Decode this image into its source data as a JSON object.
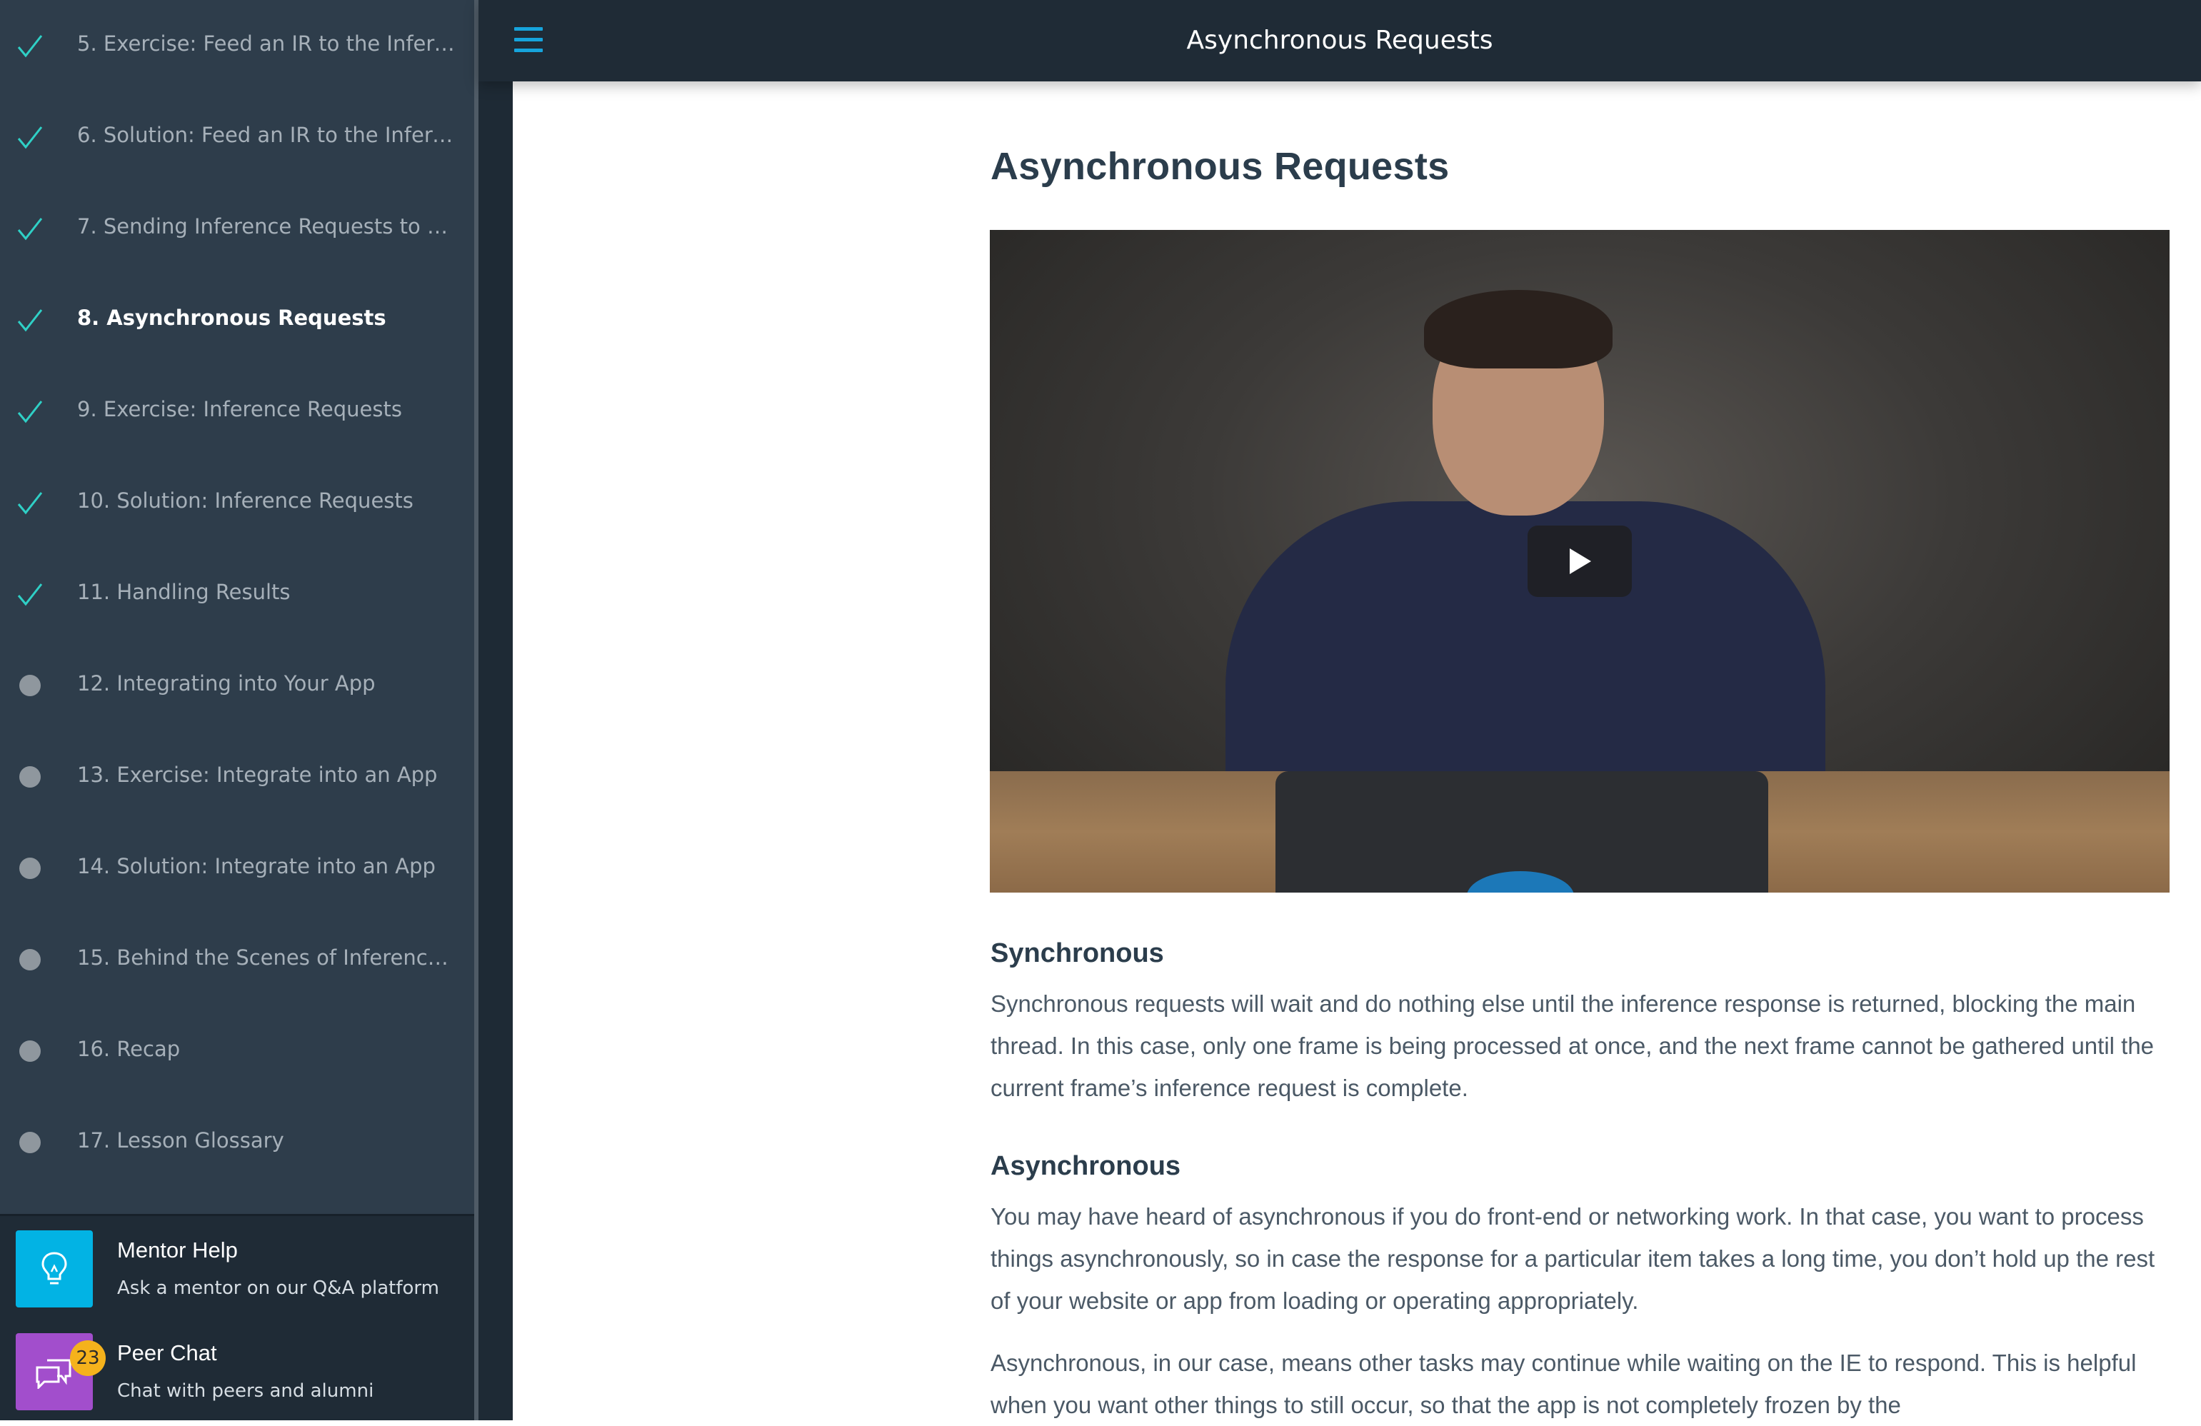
{
  "window": {
    "title": "Asynchronous Requests"
  },
  "sidebar": {
    "items": [
      {
        "label": "5. Exercise: Feed an IR to the Infere...",
        "status": "complete",
        "active": false
      },
      {
        "label": "6. Solution: Feed an IR to the Infere...",
        "status": "complete",
        "active": false
      },
      {
        "label": "7. Sending Inference Requests to th...",
        "status": "complete",
        "active": false
      },
      {
        "label": "8. Asynchronous Requests",
        "status": "complete",
        "active": true
      },
      {
        "label": "9. Exercise: Inference Requests",
        "status": "complete",
        "active": false
      },
      {
        "label": "10. Solution: Inference Requests",
        "status": "complete",
        "active": false
      },
      {
        "label": "11. Handling Results",
        "status": "complete",
        "active": false
      },
      {
        "label": "12. Integrating into Your App",
        "status": "incomplete",
        "active": false
      },
      {
        "label": "13. Exercise: Integrate into an App",
        "status": "incomplete",
        "active": false
      },
      {
        "label": "14. Solution: Integrate into an App",
        "status": "incomplete",
        "active": false
      },
      {
        "label": "15. Behind the Scenes of Inference ...",
        "status": "incomplete",
        "active": false
      },
      {
        "label": "16. Recap",
        "status": "incomplete",
        "active": false
      },
      {
        "label": "17. Lesson Glossary",
        "status": "incomplete",
        "active": false
      }
    ],
    "help": {
      "mentor": {
        "title": "Mentor Help",
        "subtitle": "Ask a mentor on our Q&A platform",
        "icon": "lightbulb-icon",
        "color": "#02b3e4"
      },
      "peer": {
        "title": "Peer Chat",
        "subtitle": "Chat with peers and alumni",
        "icon": "chat-icon",
        "color": "#a24ecc",
        "badge": "23"
      }
    }
  },
  "topbar": {
    "title": "Asynchronous Requests",
    "menu_icon": "hamburger-icon"
  },
  "main": {
    "title": "Asynchronous Requests",
    "video": {
      "play_icon": "play-icon"
    },
    "sections": [
      {
        "heading": "Synchronous",
        "paragraphs": [
          "Synchronous requests will wait and do nothing else until the inference response is returned, blocking the main thread. In this case, only one frame is being processed at once, and the next frame cannot be gathered until the current frame’s inference request is complete."
        ]
      },
      {
        "heading": "Asynchronous",
        "paragraphs": [
          "You may have heard of asynchronous if you do front-end or networking work. In that case, you want to process things asynchronously, so in case the response for a particular item takes a long time, you don’t hold up the rest of your website or app from loading or operating appropriately.",
          "Asynchronous, in our case, means other tasks may continue while waiting on the IE to respond. This is helpful when you want other things to still occur, so that the app is not completely frozen by the"
        ]
      }
    ]
  },
  "colors": {
    "accent": "#02b3e4",
    "check": "#2fd0c6",
    "sidebar_bg": "#2e3d4b",
    "topbar_bg": "#1f2b36",
    "heading": "#2b3d4c",
    "body_text": "#4b5966"
  }
}
